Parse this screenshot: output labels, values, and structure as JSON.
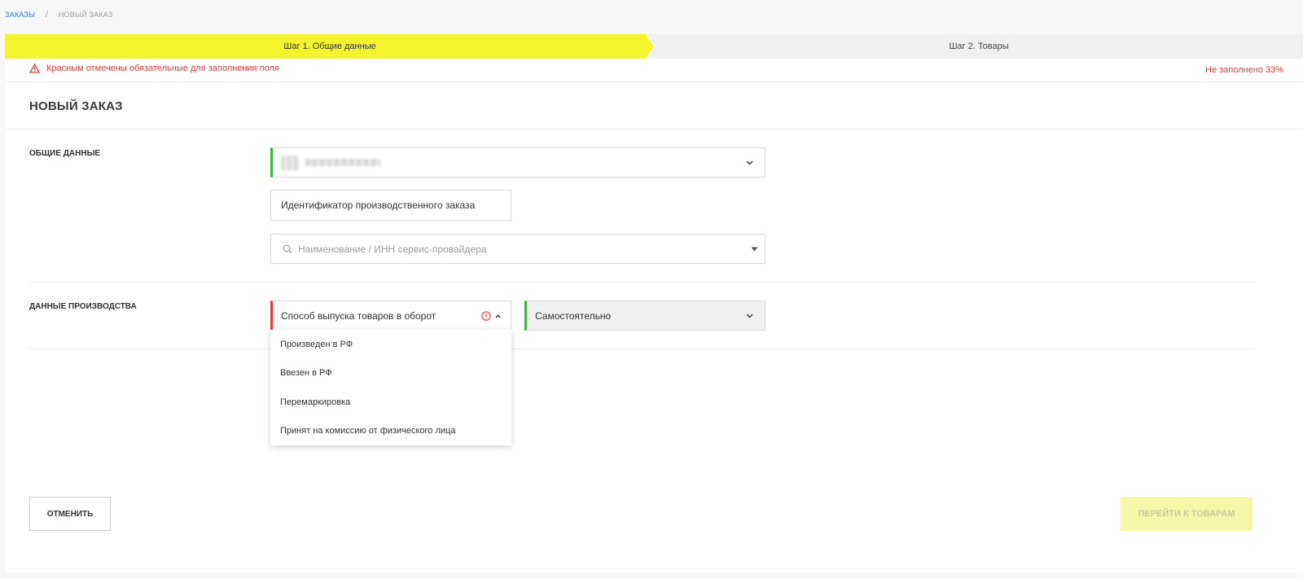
{
  "breadcrumb": {
    "root": "ЗАКАЗЫ",
    "separator": "/",
    "current": "НОВЫЙ ЗАКАЗ"
  },
  "steps": [
    {
      "label": "Шаг 1. Общие данные",
      "active": true
    },
    {
      "label": "Шаг 2. Товары",
      "active": false
    }
  ],
  "notice": {
    "text": "Красным отмечены обязательные для заполнения поля",
    "fill_status": "Не заполнено 33%"
  },
  "page_title": "НОВЫЙ ЗАКАЗ",
  "general": {
    "label": "ОБЩИЕ ДАННЫЕ",
    "order_id": "Идентификатор производственного заказа",
    "provider_placeholder": "Наименование / ИНН сервис-провайдера"
  },
  "production": {
    "label": "ДАННЫЕ ПРОИЗВОДСТВА",
    "release_method_placeholder": "Способ выпуска товаров в оборот",
    "mode_value": "Самостоятельно",
    "release_options": [
      "Произведен в РФ",
      "Ввезен в РФ",
      "Перемаркировка",
      "Принят на комиссию от физического лица"
    ]
  },
  "buttons": {
    "cancel": "ОТМЕНИТЬ",
    "next": "ПЕРЕЙТИ К ТОВАРАМ"
  },
  "colors": {
    "accent": "#f4f42d",
    "error": "#e63a3a",
    "ok": "#3bb54a",
    "link": "#2f7bd8"
  }
}
